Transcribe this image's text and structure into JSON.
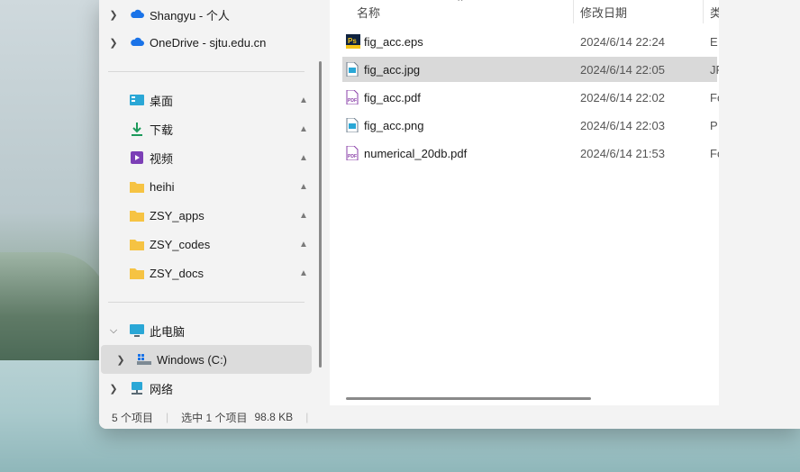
{
  "nav": {
    "cloud_items": [
      {
        "label": "Shangyu - 个人",
        "icon": "onedrive-icon"
      },
      {
        "label": "OneDrive - sjtu.edu.cn",
        "icon": "onedrive-icon"
      }
    ],
    "quick_access": [
      {
        "label": "桌面",
        "icon": "desktop-icon"
      },
      {
        "label": "下载",
        "icon": "download-icon"
      },
      {
        "label": "视频",
        "icon": "video-icon"
      },
      {
        "label": "heihi",
        "icon": "folder-icon"
      },
      {
        "label": "ZSY_apps",
        "icon": "folder-icon"
      },
      {
        "label": "ZSY_codes",
        "icon": "folder-icon"
      },
      {
        "label": "ZSY_docs",
        "icon": "folder-icon"
      }
    ],
    "this_pc": {
      "label": "此电脑",
      "icon": "computer-icon"
    },
    "drive": {
      "label": "Windows (C:)",
      "icon": "drive-icon"
    },
    "network": {
      "label": "网络",
      "icon": "network-icon"
    }
  },
  "columns": {
    "name": "名称",
    "modified": "修改日期",
    "type": "类"
  },
  "files": [
    {
      "name": "fig_acc.eps",
      "modified": "2024/6/14 22:24",
      "type": "E",
      "icon": "eps-file-icon"
    },
    {
      "name": "fig_acc.jpg",
      "modified": "2024/6/14 22:05",
      "type": "JP",
      "icon": "jpg-file-icon"
    },
    {
      "name": "fig_acc.pdf",
      "modified": "2024/6/14 22:02",
      "type": "Fo",
      "icon": "pdf-file-icon"
    },
    {
      "name": "fig_acc.png",
      "modified": "2024/6/14 22:03",
      "type": "P",
      "icon": "png-file-icon"
    },
    {
      "name": "numerical_20db.pdf",
      "modified": "2024/6/14 21:53",
      "type": "Fo",
      "icon": "pdf-file-icon"
    }
  ],
  "status": {
    "item_count": "5 个项目",
    "selection": "选中 1 个项目",
    "size": "98.8 KB"
  },
  "colors": {
    "folder": "#f6c343",
    "onedrive": "#1a73e8",
    "selected_row": "#d9d9d9"
  }
}
